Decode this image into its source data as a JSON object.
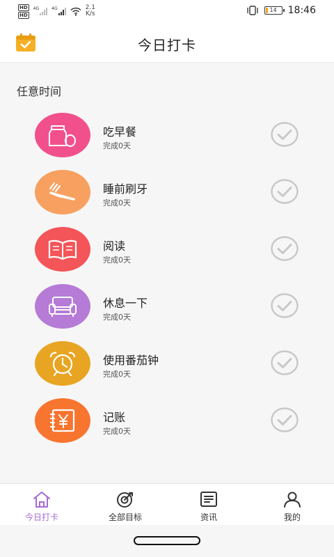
{
  "status_bar": {
    "hd1": "HD",
    "hd2": "HD",
    "net1": "4G",
    "net2": "4G",
    "speed_value": "2.1",
    "speed_unit": "K/s",
    "battery": "14",
    "battery_level": 0.14,
    "time": "18:46"
  },
  "header": {
    "title": "今日打卡",
    "calendar_icon": "calendar-check-icon"
  },
  "section": {
    "label": "任意时间"
  },
  "habits": [
    {
      "name": "吃早餐",
      "status": "完成0天",
      "color": "#f2508d",
      "icon": "breakfast-icon"
    },
    {
      "name": "睡前刷牙",
      "status": "完成0天",
      "color": "#f8a060",
      "icon": "toothbrush-icon"
    },
    {
      "name": "阅读",
      "status": "完成0天",
      "color": "#f45558",
      "icon": "book-icon"
    },
    {
      "name": "休息一下",
      "status": "完成0天",
      "color": "#b67bd7",
      "icon": "sofa-icon"
    },
    {
      "name": "使用番茄钟",
      "status": "完成0天",
      "color": "#e8a523",
      "icon": "alarm-clock-icon"
    },
    {
      "name": "记账",
      "status": "完成0天",
      "color": "#f8752f",
      "icon": "ledger-icon"
    }
  ],
  "tabs": [
    {
      "label": "今日打卡",
      "icon": "home-icon",
      "active": true
    },
    {
      "label": "全部目标",
      "icon": "target-icon",
      "active": false
    },
    {
      "label": "资讯",
      "icon": "news-icon",
      "active": false
    },
    {
      "label": "我的",
      "icon": "user-icon",
      "active": false
    }
  ],
  "colors": {
    "accent": "#a56ad4",
    "calendar": "#f5b025",
    "check": "#c8c8c8"
  }
}
